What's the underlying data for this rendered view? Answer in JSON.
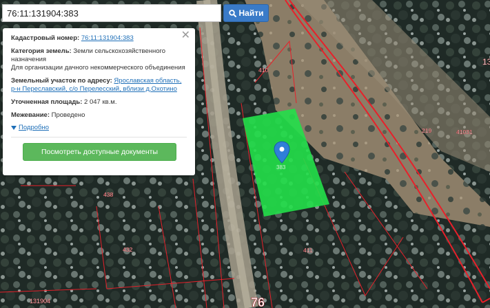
{
  "search": {
    "value": "76:11:131904:383",
    "button_label": "Найти"
  },
  "card": {
    "cadastral_label": "Кадастровый номер:",
    "cadastral_value": "76:11:131904:383",
    "category_label": "Категория земель:",
    "category_value_1": "Земли сельскохозяйственного",
    "category_value_2": "назначения",
    "category_value_3": "Для организации дачного некоммерческого объединения",
    "address_label": "Земельный участок по адресу:",
    "address_value_1": "Ярославская область,",
    "address_value_2": "р-н Переславский, с/о Перелесский, вблизи д.Охотино",
    "area_label": "Уточненная площадь:",
    "area_value": "2 047 кв.м.",
    "survey_label": "Межевание:",
    "survey_value": "Проведено",
    "more_label": "Подробно",
    "docs_button": "Посмотреть доступные документы"
  },
  "map": {
    "parcel_labels": [
      "410",
      "219",
      "41031",
      "438",
      "432",
      "411",
      "131904",
      "76",
      "13"
    ],
    "selected_parcel_label": "383",
    "colors": {
      "boundary": "#e8202a",
      "selected_fill": "#22e04a",
      "marker": "#2f7fd8"
    }
  }
}
